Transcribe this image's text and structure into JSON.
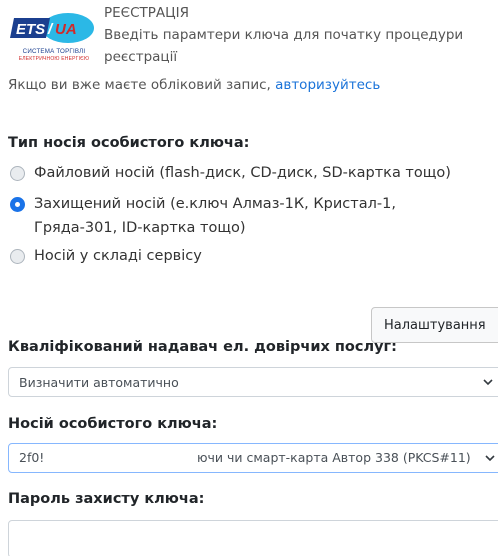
{
  "logo": {
    "badge_text": "ETS/UA",
    "sub_line1": "СИСТЕМА ТОРГІВЛІ",
    "sub_line2": "ЕЛЕКТРИЧНОЮ ЕНЕРГІЄЮ",
    "colors": {
      "blue": "#1b3f8f",
      "red": "#d12a2a",
      "cyan": "#2bb8e6"
    }
  },
  "header": {
    "title": "РЕЄСТРАЦІЯ",
    "description": "Введіть парамтери ключа для початку процедури реєстрації"
  },
  "auth": {
    "prefix": "Якщо ви вже маєте обліковий запис, ",
    "link_text": "авторизуйтесь"
  },
  "carrier_type": {
    "title": "Тип носія особистого ключа:",
    "options": [
      {
        "label": "Файловий носій (flash-диск, CD-диск, SD-картка тощо)",
        "checked": false
      },
      {
        "label": "Захищений носій (е.ключ Алмаз-1К, Кристал-1, Гряда-301, ID-картка тощо)",
        "checked": true
      },
      {
        "label": "Носій у складі сервісу",
        "checked": false
      }
    ]
  },
  "settings_button": {
    "label": "Налаштування"
  },
  "provider": {
    "title": "Кваліфікований надавач ел. довірчих послуг:",
    "selected": "Визначити автоматично"
  },
  "key_carrier": {
    "title": "Носій особистого ключа:",
    "selected_left": "2f0!",
    "selected_right": "ючи чи смарт-карта Автор 338 (PKCS#11)"
  },
  "password": {
    "title": "Пароль захисту ключа:",
    "value": ""
  },
  "accent_color": "#1a73e8"
}
